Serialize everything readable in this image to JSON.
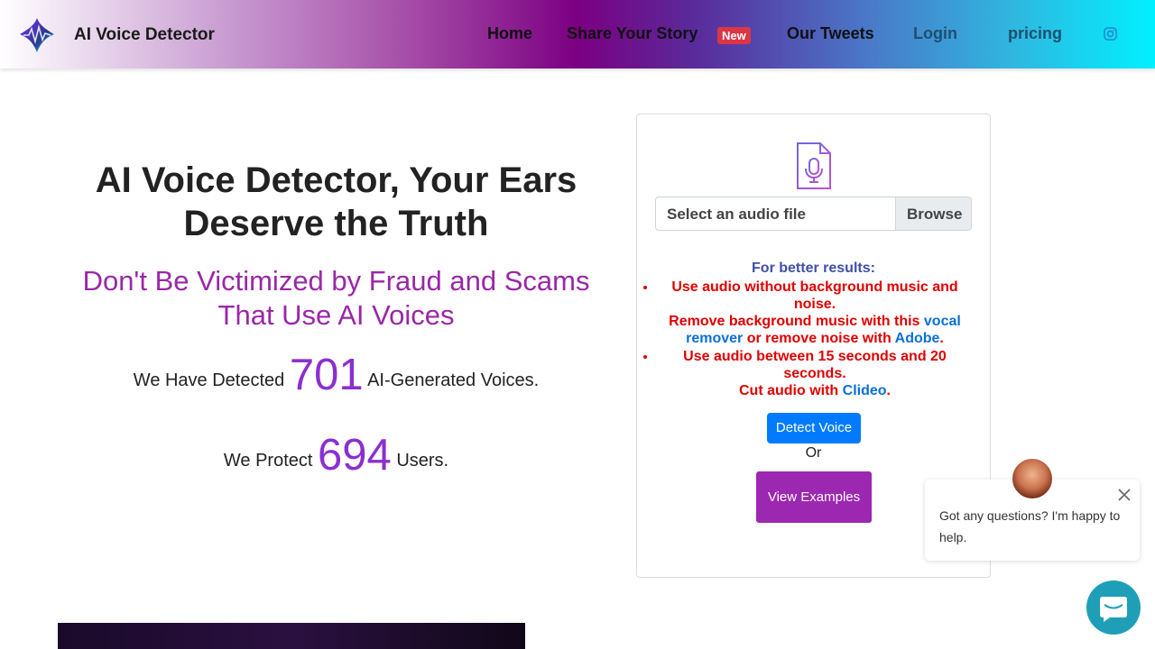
{
  "nav": {
    "brand": "AI Voice Detector",
    "home": "Home",
    "story": "Share Your Story",
    "story_badge": "New",
    "tweets": "Our Tweets",
    "login": "Login",
    "pricing": "pricing",
    "social_icon": "instagram-icon"
  },
  "hero": {
    "title": "AI Voice Detector, Your Ears Deserve the Truth",
    "subtitle": "Don't Be Victimized by Fraud and Scams That Use AI Voices",
    "detected_prefix": "We Have Detected",
    "detected_count": "701",
    "detected_suffix": "AI-Generated Voices.",
    "protect_prefix": "We Protect",
    "protect_count": "694",
    "protect_suffix": "Users."
  },
  "upload": {
    "file_icon": "audio-file-icon",
    "placeholder": "Select an audio file",
    "browse": "Browse",
    "tips_heading": "For better results:",
    "tip1_a": "Use audio without background music and noise.",
    "tip1_b": "Remove background music with this",
    "tip1_link1": "vocal remover",
    "tip1_c": "or remove noise with",
    "tip1_link2": "Adobe",
    "tip1_d": ".",
    "tip2_a": "Use audio between 15 seconds and 20 seconds.",
    "tip2_b": "Cut audio with",
    "tip2_link": "Clideo",
    "tip2_c": ".",
    "detect_button": "Detect Voice",
    "or": "Or",
    "examples_button": "View Examples"
  },
  "chat": {
    "message": "Got any questions? I'm happy to help."
  },
  "colors": {
    "accent_purple": "#9c27b0",
    "count_purple": "#8b2fd0",
    "primary_blue": "#007bff",
    "tip_red": "#e00000",
    "chat_teal": "#1e9fb7"
  }
}
